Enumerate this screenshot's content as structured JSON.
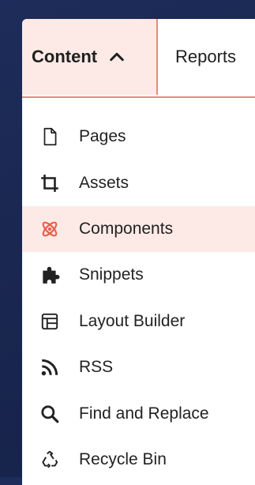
{
  "tabs": {
    "content_label": "Content",
    "reports_label": "Reports"
  },
  "menu": {
    "items": [
      {
        "label": "Pages",
        "icon": "page-icon"
      },
      {
        "label": "Assets",
        "icon": "crop-icon"
      },
      {
        "label": "Components",
        "icon": "atom-icon",
        "active": true
      },
      {
        "label": "Snippets",
        "icon": "puzzle-icon"
      },
      {
        "label": "Layout Builder",
        "icon": "layout-icon"
      },
      {
        "label": "RSS",
        "icon": "rss-icon"
      },
      {
        "label": "Find and Replace",
        "icon": "search-icon"
      },
      {
        "label": "Recycle Bin",
        "icon": "recycle-icon"
      }
    ]
  },
  "colors": {
    "accent": "#e8604c",
    "active_bg": "#fdeae6",
    "background": "#1d2c5a"
  }
}
